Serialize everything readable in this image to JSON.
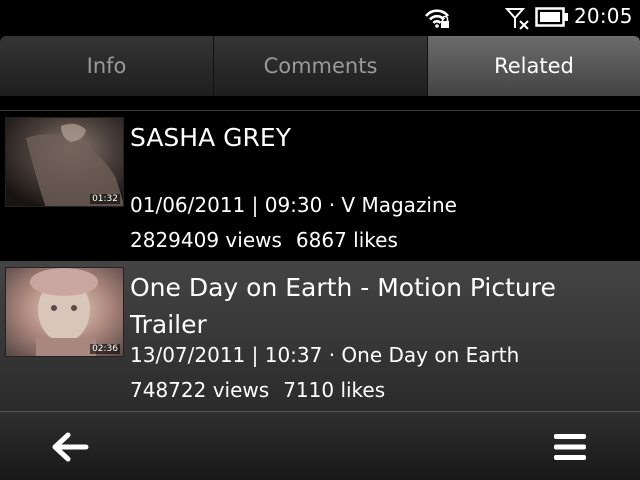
{
  "status_bar": {
    "time": "20:05",
    "icons": [
      "wifi-locked-icon",
      "signal-off-icon",
      "battery-icon"
    ]
  },
  "tabs": [
    {
      "label": "Info",
      "active": false
    },
    {
      "label": "Comments",
      "active": false
    },
    {
      "label": "Related",
      "active": true
    }
  ],
  "related_videos": [
    {
      "title": "SASHA GREY",
      "duration": "01:32",
      "date_line": "01/06/2011 | 09:30 · V Magazine",
      "views": "2829409 views",
      "likes": "6867 likes"
    },
    {
      "title": "One Day on Earth - Motion Picture Trailer",
      "duration": "02:36",
      "date_line": "13/07/2011 | 10:37 · One Day on Earth",
      "views": "748722 views",
      "likes": "7110 likes"
    }
  ],
  "toolbar": {
    "icons": [
      "back-arrow-icon",
      "menu-icon"
    ]
  },
  "colors": {
    "background": "#000000",
    "tab_active": "#5a5a5a",
    "tab_inactive": "#2a2a2a",
    "selected_row": "#3a3a3a"
  }
}
